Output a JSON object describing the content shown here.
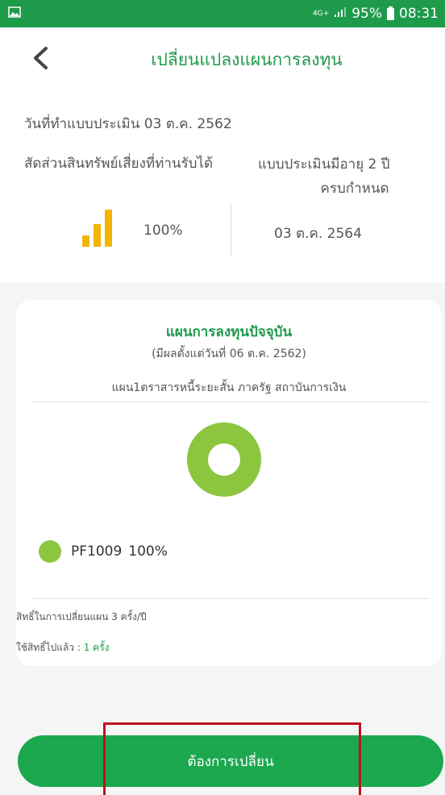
{
  "status_bar": {
    "network": "4G+",
    "battery": "95%",
    "time": "08:31",
    "icons": [
      "image-icon",
      "signal-icon",
      "battery-icon"
    ]
  },
  "header": {
    "title": "เปลี่ยนแปลงแผนการลงทุน",
    "back_icon": "chevron-left-icon"
  },
  "assessment": {
    "date_text": "วันที่ทำแบบประเมิน 03 ต.ค. 2562",
    "risk_label": "สัดส่วนสินทรัพย์เสี่ยงที่ท่านรับได้",
    "validity_label_line1": "แบบประเมินมีอายุ 2 ปี",
    "validity_label_line2": "ครบกำหนด",
    "risk_value": "100%",
    "expiry_date": "03 ต.ค. 2564",
    "risk_icon": "bar-level-icon"
  },
  "current_plan": {
    "title": "แผนการลงทุนปัจจุบัน",
    "effective": "(มีผลตั้งแต่วันที่ 06 ต.ค. 2562)",
    "plan_name": "แผน1ตราสารหนี้ระยะสั้น ภาครัฐ สถาบันการเงิน",
    "allocation": [
      {
        "code": "PF1009",
        "percent": "100%",
        "color": "#8cc63f"
      }
    ],
    "rights_text": "สิทธิ์ในการเปลี่ยนแผน 3 ครั้ง/ปี",
    "used_prefix": "ใช้สิทธิ์ไปแล้ว : ",
    "used_value": "1 ครั้ง"
  },
  "action": {
    "button_label": "ต้องการเปลี่ยน"
  },
  "colors": {
    "brand_green": "#1e9a4b",
    "donut": "#8cc63f",
    "highlight": "#c0121b"
  }
}
